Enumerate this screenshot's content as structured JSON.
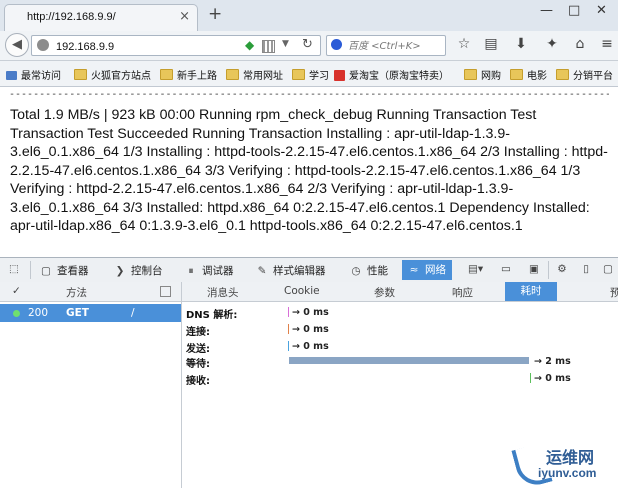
{
  "browser": {
    "tab_title": "http://192.168.9.9/",
    "tab_close": "×",
    "new_tab": "+",
    "window_controls": [
      "—",
      "□",
      "✕"
    ]
  },
  "nav": {
    "back": "◀",
    "url": "192.168.9.9",
    "reload": "↻",
    "search_placeholder": "百度 <Ctrl+K>",
    "toolbar_icons": [
      "star-icon",
      "reading-list-icon",
      "download-icon",
      "addons-icon",
      "home-icon",
      "menu-icon"
    ]
  },
  "bookmarks": [
    {
      "label": "最常访问",
      "icon": "star"
    },
    {
      "label": "火狐官方站点",
      "icon": "folder"
    },
    {
      "label": "新手上路",
      "icon": "folder"
    },
    {
      "label": "常用网址",
      "icon": "folder"
    },
    {
      "label": "学习",
      "icon": "folder"
    },
    {
      "label": "爱淘宝（原淘宝特卖）",
      "icon": "red"
    },
    {
      "label": "网购",
      "icon": "folder"
    },
    {
      "label": "电影",
      "icon": "folder"
    },
    {
      "label": "分销平台",
      "icon": "folder"
    }
  ],
  "page": {
    "dashes": "--------------------------------------------------------------------------------------------------------",
    "output": "Total 1.9 MB/s | 923 kB 00:00 Running rpm_check_debug Running Transaction Test Transaction Test Succeeded Running Transaction Installing : apr-util-ldap-1.3.9-3.el6_0.1.x86_64 1/3 Installing : httpd-tools-2.2.15-47.el6.centos.1.x86_64 2/3 Installing : httpd-2.2.15-47.el6.centos.1.x86_64 3/3 Verifying : httpd-tools-2.2.15-47.el6.centos.1.x86_64 1/3 Verifying : httpd-2.2.15-47.el6.centos.1.x86_64 2/3 Verifying : apr-util-ldap-1.3.9-3.el6_0.1.x86_64 3/3 Installed: httpd.x86_64 0:2.2.15-47.el6.centos.1 Dependency Installed: apr-util-ldap.x86_64 0:1.3.9-3.el6_0.1 httpd-tools.x86_64 0:2.2.15-47.el6.centos.1"
  },
  "devtools": {
    "tabs": {
      "inspector": "查看器",
      "console": "控制台",
      "debugger": "调试器",
      "style_editor": "样式编辑器",
      "performance": "性能",
      "network": "网络"
    },
    "columns": {
      "check": "✓",
      "method": "方法",
      "headers": "消息头",
      "cookie": "Cookie",
      "params": "参数",
      "response": "响应",
      "timings": "耗时",
      "preview": "预"
    },
    "request": {
      "status": "200",
      "method": "GET",
      "file": "/"
    },
    "timings": [
      {
        "label": "DNS 解析:",
        "value": "→ 0 ms",
        "ms": 0,
        "color": "#d86fd8"
      },
      {
        "label": "连接:",
        "value": "→ 0 ms",
        "ms": 0,
        "color": "#e0814a"
      },
      {
        "label": "发送:",
        "value": "→ 0 ms",
        "ms": 0,
        "color": "#4aa3df"
      },
      {
        "label": "等待:",
        "value": "→ 2 ms",
        "ms": 2,
        "color": "#8aa5c4"
      },
      {
        "label": "接收:",
        "value": "→ 0 ms",
        "ms": 0,
        "color": "#5cbf5c"
      }
    ]
  },
  "watermark": {
    "cn": "运维网",
    "en": "iyunv.com"
  }
}
